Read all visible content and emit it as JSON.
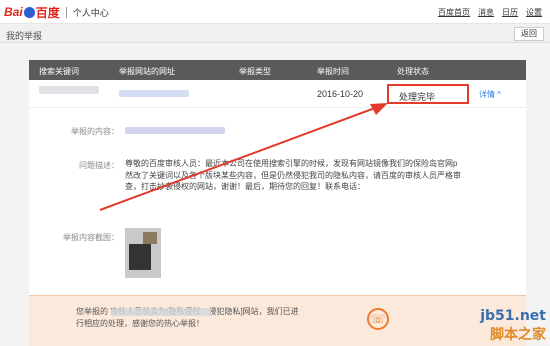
{
  "header": {
    "logo_bai": "Bai",
    "logo_du": "百度",
    "section": "个人中心",
    "links": [
      "百度首页",
      "消息",
      "日历",
      "设置"
    ]
  },
  "subheader": {
    "title": "我的举报",
    "back_label": "返回"
  },
  "table": {
    "columns": [
      "搜索关键词",
      "举报网站的网址",
      "举报类型",
      "举报时间",
      "处理状态"
    ],
    "row": {
      "date": "2016-10-20",
      "status": "处理完毕",
      "detail_link": "详情",
      "detail_icon": "chevron-up-icon"
    }
  },
  "detail": {
    "content_label": "举报的内容：",
    "desc_label": "问题描述：",
    "desc_text": "尊敬的百度审核人员：最近本公司在使用搜索引擎的时候，发现有网站镜像我们的保险岛官网p 然改了关键词以及各个版块某些内容，但是仍然侵犯我司的隐私内容，请百度的审核人员严格审查，打击抄袭侵权的网站，谢谢！最后，期待您的回复！联系电话：",
    "screenshot_label": "举报内容截图："
  },
  "footer": {
    "message": "您举报的 审核人员核实为[隐私侵权：侵犯隐私]网站，我们已进行相应的处理，感谢您的热心举报！",
    "phone_icon": "phone-icon"
  },
  "watermark": {
    "site": "jb51.net",
    "cn": "脚本之家"
  },
  "colors": {
    "accent_red": "#e23b2c",
    "link_blue": "#2b7de0",
    "header_dark": "#5a5a5a",
    "footer_bg": "#fbe9db"
  }
}
